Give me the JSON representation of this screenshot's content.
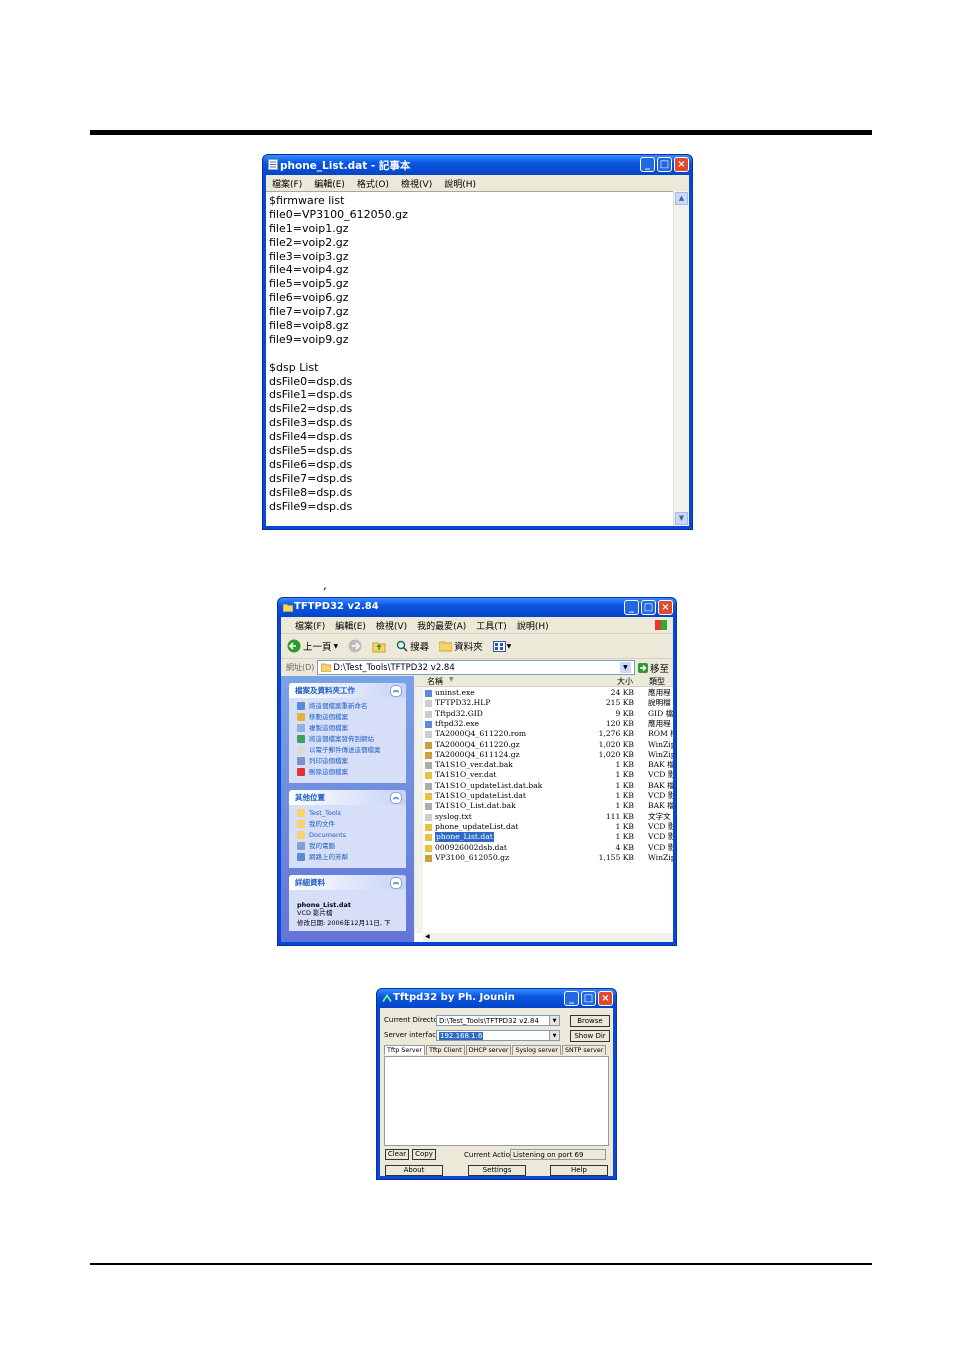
{
  "notepad": {
    "title": "phone_List.dat - 記事本",
    "menu": [
      "檔案(F)",
      "編輯(E)",
      "格式(O)",
      "檢視(V)",
      "說明(H)"
    ],
    "lines": [
      "$firmware list",
      "file0=VP3100_612050.gz",
      "file1=voip1.gz",
      "file2=voip2.gz",
      "file3=voip3.gz",
      "file4=voip4.gz",
      "file5=voip5.gz",
      "file6=voip6.gz",
      "file7=voip7.gz",
      "file8=voip8.gz",
      "file9=voip9.gz",
      "",
      "$dsp List",
      "dsFile0=dsp.ds",
      "dsFile1=dsp.ds",
      "dsFile2=dsp.ds",
      "dsFile3=dsp.ds",
      "dsFile4=dsp.ds",
      "dsFile5=dsp.ds",
      "dsFile6=dsp.ds",
      "dsFile7=dsp.ds",
      "dsFile8=dsp.ds",
      "dsFile9=dsp.ds"
    ]
  },
  "comma": ",",
  "explorer": {
    "title": "TFTPD32 v2.84",
    "menu": [
      "檔案(F)",
      "編輯(E)",
      "檢視(V)",
      "我的最愛(A)",
      "工具(T)",
      "說明(H)"
    ],
    "toolbar": {
      "back": "上一頁",
      "search": "搜尋",
      "folders": "資料夾"
    },
    "address_label": "網址(D)",
    "address_value": "D:\\Test_Tools\\TFTPD32 v2.84",
    "go_label": "移至",
    "tasks_header": "檔案及資料夾工作",
    "tasks": [
      "將這個檔案重新命名",
      "移動這個檔案",
      "複製這個檔案",
      "將這個檔案發佈到網站",
      "以電子郵件傳送這個檔案",
      "列印這個檔案",
      "刪除這個檔案"
    ],
    "places_header": "其他位置",
    "places": [
      "Test_Tools",
      "我的文件",
      "Documents",
      "我的電腦",
      "網路上的芳鄰"
    ],
    "details_header": "詳細資料",
    "details_name": "phone_List.dat",
    "details_type": "VCD 影片檔",
    "details_date": "修改日期: 2006年12月11日, 下",
    "columns": {
      "name": "名稱",
      "size": "大小",
      "type": "類型"
    },
    "files": [
      {
        "name": "uninst.exe",
        "size": "24 KB",
        "type": "應用程"
      },
      {
        "name": "TFTPD32.HLP",
        "size": "215 KB",
        "type": "說明檔"
      },
      {
        "name": "Tftpd32.GID",
        "size": "9 KB",
        "type": "GID 檔"
      },
      {
        "name": "tftpd32.exe",
        "size": "120 KB",
        "type": "應用程"
      },
      {
        "name": "TA2000Q4_611220.rom",
        "size": "1,276 KB",
        "type": "ROM 檔"
      },
      {
        "name": "TA2000Q4_611220.gz",
        "size": "1,020 KB",
        "type": "WinZip"
      },
      {
        "name": "TA2000Q4_611124.gz",
        "size": "1,020 KB",
        "type": "WinZip"
      },
      {
        "name": "TA1S1O_ver.dat.bak",
        "size": "1 KB",
        "type": "BAK 檔"
      },
      {
        "name": "TA1S1O_ver.dat",
        "size": "1 KB",
        "type": "VCD 影"
      },
      {
        "name": "TA1S1O_updateList.dat.bak",
        "size": "1 KB",
        "type": "BAK 檔"
      },
      {
        "name": "TA1S1O_updateList.dat",
        "size": "1 KB",
        "type": "VCD 影"
      },
      {
        "name": "TA1S1O_List.dat.bak",
        "size": "1 KB",
        "type": "BAK 檔"
      },
      {
        "name": "syslog.txt",
        "size": "111 KB",
        "type": "文字文"
      },
      {
        "name": "phone_updateList.dat",
        "size": "1 KB",
        "type": "VCD 影"
      },
      {
        "name": "phone_List.dat",
        "size": "1 KB",
        "type": "VCD 影"
      },
      {
        "name": "000926002dsb.dat",
        "size": "4 KB",
        "type": "VCD 影"
      },
      {
        "name": "VP3100_612050.gz",
        "size": "1,155 KB",
        "type": "WinZip"
      }
    ]
  },
  "tftpd": {
    "title": "Tftpd32 by Ph. Jounin",
    "current_dir_label": "Current Directory",
    "current_dir_value": "D:\\Test_Tools\\TFTPD32 v2.84",
    "browse_label": "Browse",
    "server_if_label": "Server interface",
    "server_if_value": "192.168.1.6",
    "showdir_label": "Show Dir",
    "tabs": [
      "Tftp Server",
      "Tftp Client",
      "DHCP server",
      "Syslog server",
      "SNTP server"
    ],
    "clear_label": "Clear",
    "copy_label": "Copy",
    "current_action_label": "Current Action",
    "current_action_value": "Listening on port 69",
    "about_label": "About",
    "settings_label": "Settings",
    "help_label": "Help"
  }
}
